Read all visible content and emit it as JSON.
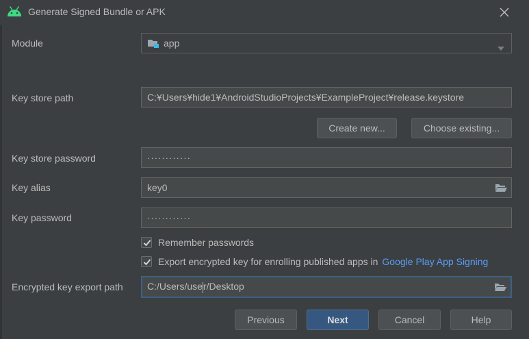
{
  "window": {
    "title": "Generate Signed Bundle or APK",
    "android_icon": "android-icon",
    "close_icon": "close-icon"
  },
  "module": {
    "label": "Module",
    "value": "app",
    "icon": "module-folder-icon"
  },
  "keystore": {
    "path_label": "Key store path",
    "path_value": "C:¥Users¥hide1¥AndroidStudioProjects¥ExampleProject¥release.keystore",
    "create_new_label": "Create new...",
    "choose_existing_label": "Choose existing...",
    "password_label": "Key store password",
    "password_value": "············"
  },
  "key": {
    "alias_label": "Key alias",
    "alias_value": "key0",
    "password_label": "Key password",
    "password_value": "············"
  },
  "options": {
    "remember_passwords_label": "Remember passwords",
    "remember_passwords_checked": true,
    "export_encrypted_label": "Export encrypted key for enrolling published apps in",
    "export_encrypted_checked": true,
    "export_link": "Google Play App Signing"
  },
  "export_path": {
    "label": "Encrypted key export path",
    "value_before_caret": "C:/Users/use",
    "value_after_caret": "r/Desktop"
  },
  "footer": {
    "previous_label": "Previous",
    "next_label": "Next",
    "cancel_label": "Cancel",
    "help_label": "Help"
  },
  "colors": {
    "background": "#3c3f41",
    "field_bg": "#45494a",
    "primary_button": "#365880",
    "link": "#589df6",
    "focus_border": "#3d6185"
  }
}
